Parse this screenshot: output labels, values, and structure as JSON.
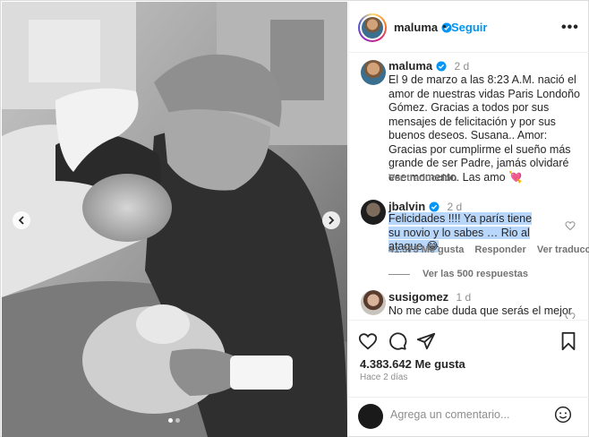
{
  "header": {
    "username": "maluma",
    "separator": "•",
    "follow_label": "Seguir",
    "more_label": "•••"
  },
  "caption": {
    "username": "maluma",
    "time": "2 d",
    "text": "El 9 de marzo a las 8:23 A.M. nació el amor de nuestras vidas Paris Londoño Gómez. Gracias a todos por sus mensajes de felicitación y por sus buenos deseos. Susana.. Amor: Gracias por cumplirme el sueño más grande de ser Padre, jamás olvidaré ese momento. Las amo 💘",
    "see_translation": "Ver traducción"
  },
  "comments": [
    {
      "username": "jbalvin",
      "time": "2 d",
      "text": "Felicidades !!!! Ya parís tiene su novio y lo sabes … Rio al ataque 😂",
      "likes": "41.373 Me gusta",
      "reply_label": "Responder",
      "translate_label": "Ver traducción",
      "replies_label": "Ver las 500 respuestas"
    },
    {
      "username": "susigomez",
      "time": "1 d",
      "text": "No me cabe duda que serás el mejor"
    }
  ],
  "post": {
    "likes": "4.383.642 Me gusta",
    "time_ago": "Hace 2 días"
  },
  "add_comment": {
    "placeholder": "Agrega un comentario..."
  },
  "carousel": {
    "slide_count": 2,
    "active_index": 0
  },
  "colors": {
    "follow_blue": "#0095f6",
    "highlight": "#b8d7fb",
    "verified": "#0095f6"
  }
}
